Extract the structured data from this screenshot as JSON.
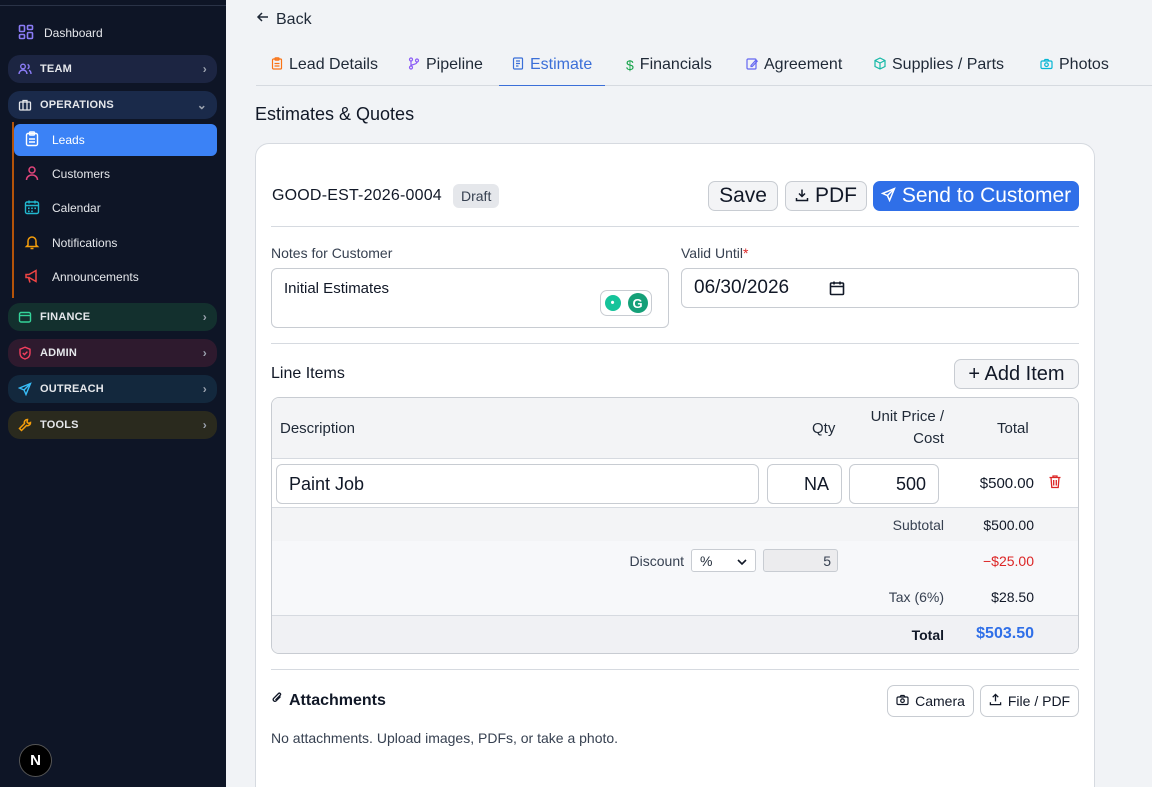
{
  "sidebar": {
    "dashboard": "Dashboard",
    "groups": {
      "team": "TEAM",
      "operations": "OPERATIONS",
      "finance": "FINANCE",
      "admin": "ADMIN",
      "outreach": "OUTREACH",
      "tools": "TOOLS"
    },
    "operations_items": [
      "Leads",
      "Customers",
      "Calendar",
      "Notifications",
      "Announcements"
    ],
    "logo": "N",
    "colors": {
      "bg": "#0e1526",
      "active": "#3b82f6"
    }
  },
  "back_label": "Back",
  "tabs": [
    "Lead Details",
    "Pipeline",
    "Estimate",
    "Financials",
    "Agreement",
    "Supplies / Parts",
    "Photos"
  ],
  "active_tab": "Estimate",
  "section_title": "Estimates & Quotes",
  "estimate": {
    "number": "GOOD-EST-2026-0004",
    "status": "Draft",
    "save_label": "Save",
    "pdf_label": "PDF",
    "send_label": "Send to Customer",
    "notes_label": "Notes for Customer",
    "notes_value": "Initial Estimates",
    "valid_until_label": "Valid Until",
    "required_mark": "*",
    "valid_until_value": "06/30/2026"
  },
  "line_items": {
    "title": "Line Items",
    "add_label": "+ Add Item",
    "headers": {
      "description": "Description",
      "qty": "Qty",
      "unit_price_1": "Unit Price /",
      "unit_price_2": "Cost",
      "total": "Total"
    },
    "rows": [
      {
        "description": "Paint Job",
        "qty": "NA",
        "unit_price": "500",
        "total": "$500.00"
      }
    ],
    "subtotal_label": "Subtotal",
    "subtotal_value": "$500.00",
    "discount_label": "Discount",
    "discount_type": "%",
    "discount_amount": "5",
    "discount_value": "−$25.00",
    "tax_label": "Tax (6%)",
    "tax_value": "$28.50",
    "total_label": "Total",
    "total_value": "$503.50"
  },
  "attachments": {
    "title": "Attachments",
    "camera_label": "Camera",
    "file_label": "File / PDF",
    "empty_note": "No attachments. Upload images, PDFs, or take a photo."
  }
}
